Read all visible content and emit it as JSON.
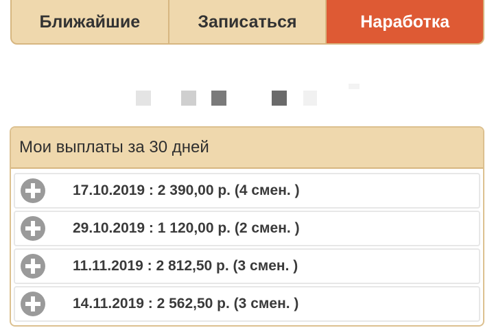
{
  "tabs": [
    {
      "label": "Ближайшие"
    },
    {
      "label": "Записаться"
    },
    {
      "label": "Наработка"
    }
  ],
  "active_tab_index": 2,
  "colors": {
    "tab_bg": "#efd8ad",
    "tab_border": "#d7b680",
    "active_tab": "#de5a34",
    "plus_icon": "#9a9a9a"
  },
  "payments": {
    "title": "Мои выплаты за 30 дней",
    "items": [
      {
        "text": "17.10.2019 : 2 390,00 р. (4 смен. )",
        "icon": "plus-circle-icon"
      },
      {
        "text": "29.10.2019 : 1 120,00 р. (2 смен. )",
        "icon": "plus-circle-icon"
      },
      {
        "text": "11.11.2019 : 2 812,50 р. (3 смен. )",
        "icon": "plus-circle-icon"
      },
      {
        "text": "14.11.2019 : 2 562,50 р. (3 смен. )",
        "icon": "plus-circle-icon"
      }
    ]
  }
}
